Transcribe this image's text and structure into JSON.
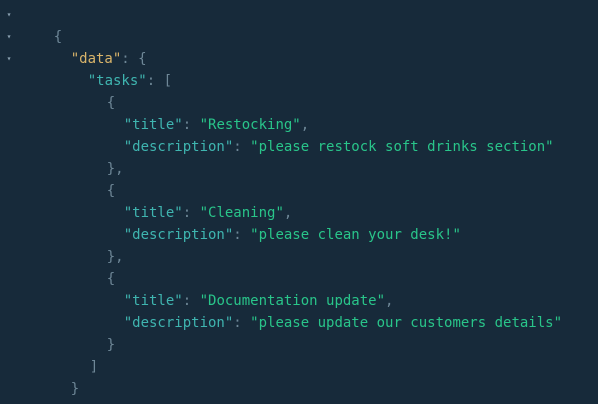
{
  "toggle_glyph": "▾",
  "punct": {
    "open_brace": "{",
    "close_brace": "}",
    "open_bracket": "[",
    "close_bracket": "]",
    "colon": ": ",
    "comma": ",",
    "close_brace_comma": "},"
  },
  "json": {
    "data_key": "\"data\"",
    "tasks_key": "\"tasks\"",
    "title_key": "\"title\"",
    "description_key": "\"description\"",
    "tasks": [
      {
        "title": "\"Restocking\"",
        "description": "\"please restock soft drinks section\""
      },
      {
        "title": "\"Cleaning\"",
        "description": "\"please clean your desk!\""
      },
      {
        "title": "\"Documentation update\"",
        "description": "\"please update our customers details\""
      }
    ]
  },
  "colors": {
    "background": "#172a3a",
    "top_key": "#d9b46a",
    "key": "#3fb5b0",
    "string": "#29c58a",
    "punctuation": "#6e8797"
  }
}
